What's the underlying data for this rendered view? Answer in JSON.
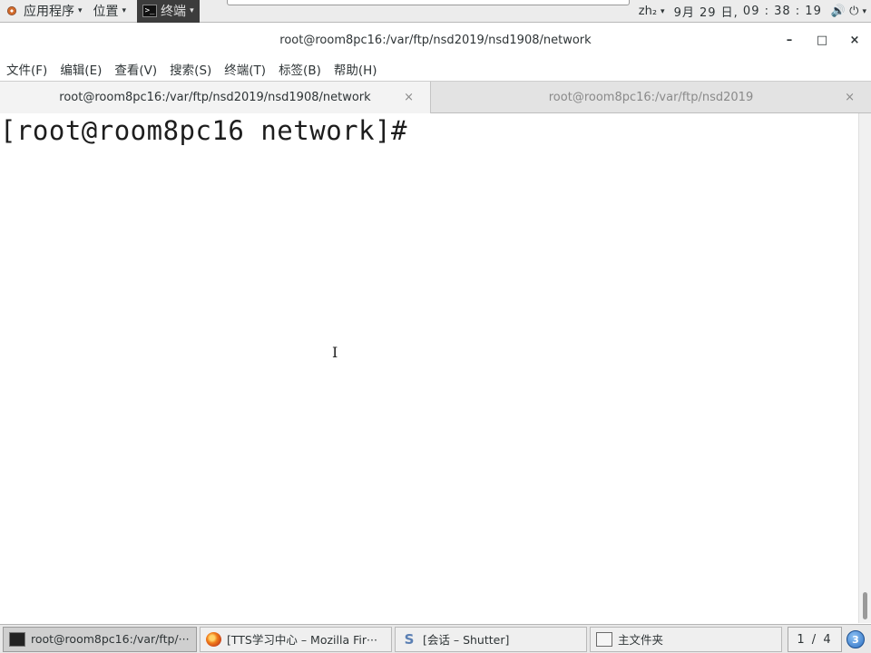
{
  "top_panel": {
    "applications": "应用程序",
    "places": "位置",
    "active_app": "终端",
    "terminal_glyph": ">_",
    "caret": "▾",
    "input_method": "zh₂",
    "date": "9月 29 日,",
    "time": "09 : 38 : 19",
    "volume_icon": "🔊",
    "power_icon": "⏻"
  },
  "window": {
    "title": "root@room8pc16:/var/ftp/nsd2019/nsd1908/network",
    "minimize": "–",
    "maximize": "□",
    "close": "×"
  },
  "menu": {
    "items": [
      {
        "label": "文件(F)"
      },
      {
        "label": "编辑(E)"
      },
      {
        "label": "查看(V)"
      },
      {
        "label": "搜索(S)"
      },
      {
        "label": "终端(T)"
      },
      {
        "label": "标签(B)"
      },
      {
        "label": "帮助(H)"
      }
    ]
  },
  "tabs": [
    {
      "label": "root@room8pc16:/var/ftp/nsd2019/nsd1908/network",
      "close": "×",
      "active": true
    },
    {
      "label": "root@room8pc16:/var/ftp/nsd2019",
      "close": "×",
      "active": false
    }
  ],
  "terminal": {
    "prompt": "[root@room8pc16 network]#",
    "cursor": "I"
  },
  "taskbar": {
    "tasks": [
      {
        "label": "root@room8pc16:/var/ftp/···",
        "icon": "terminal-icon"
      },
      {
        "label": "[TTS学习中心 – Mozilla Fir···",
        "icon": "firefox-icon"
      },
      {
        "label": "[会话 – Shutter]",
        "icon": "shutter-icon",
        "glyph": "S"
      },
      {
        "label": "主文件夹",
        "icon": "folder-icon"
      }
    ],
    "pager": "1 / 4",
    "notifications": "3"
  },
  "colors": {
    "panel_bg": "#ececec",
    "tabs_bg": "#e3e3e3",
    "terminal_bg": "#ffffff",
    "terminal_fg": "#1d1d1d",
    "active_task_bg": "#cfcfcf"
  }
}
